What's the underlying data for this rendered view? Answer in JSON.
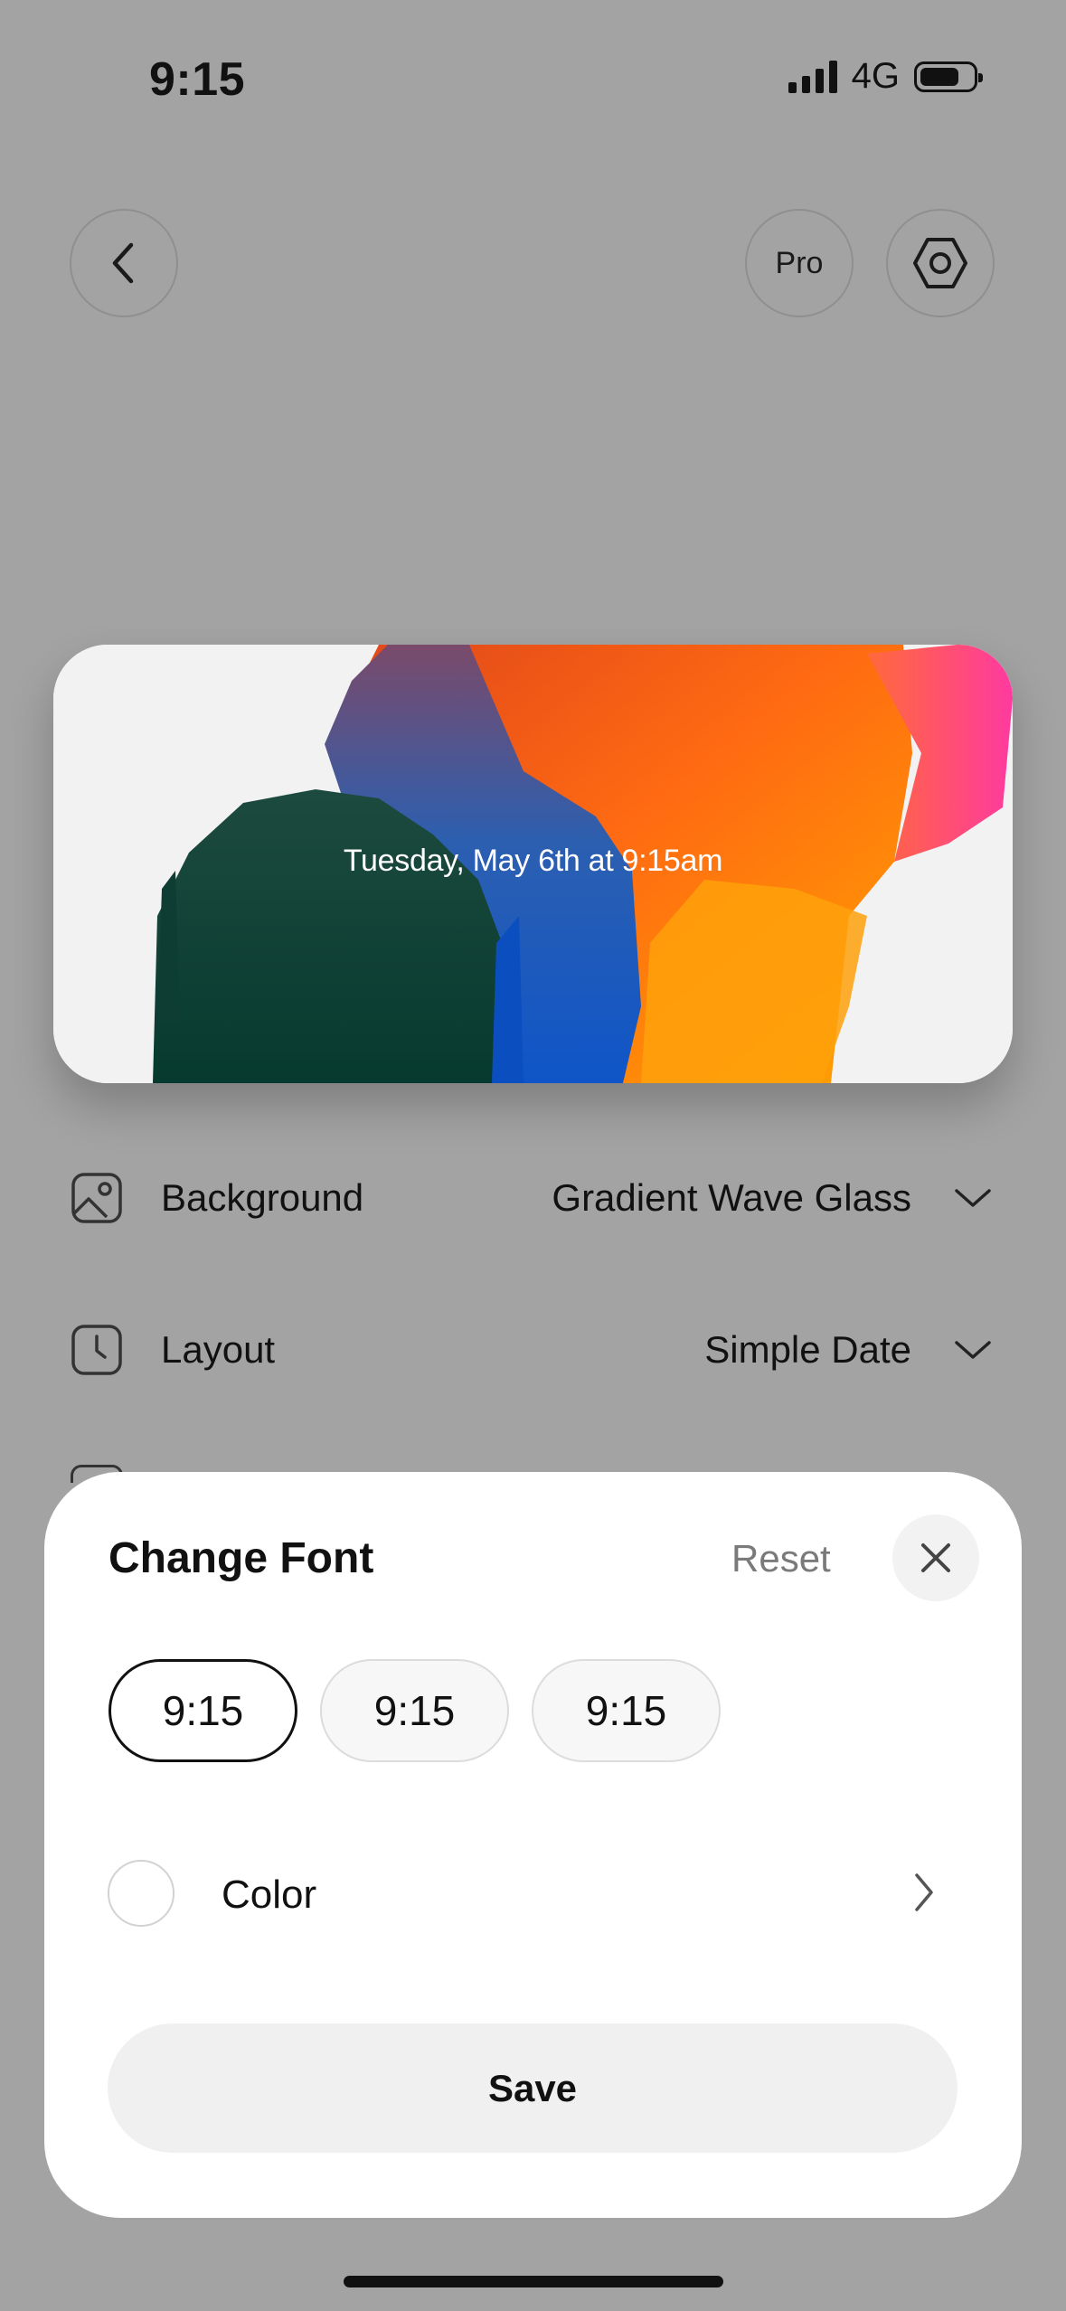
{
  "status_bar": {
    "time": "9:15",
    "network": "4G"
  },
  "header": {
    "pro_label": "Pro"
  },
  "preview": {
    "text": "Tuesday, May 6th at 9:15am"
  },
  "settings": [
    {
      "label": "Background",
      "value": "Gradient Wave Glass",
      "icon": "image-icon"
    },
    {
      "label": "Layout",
      "value": "Simple Date",
      "icon": "clock-icon"
    }
  ],
  "sheet": {
    "title": "Change Font",
    "reset_label": "Reset",
    "font_options": [
      "9:15",
      "9:15",
      "9:15"
    ],
    "selected_font_index": 0,
    "color_label": "Color",
    "save_label": "Save"
  }
}
